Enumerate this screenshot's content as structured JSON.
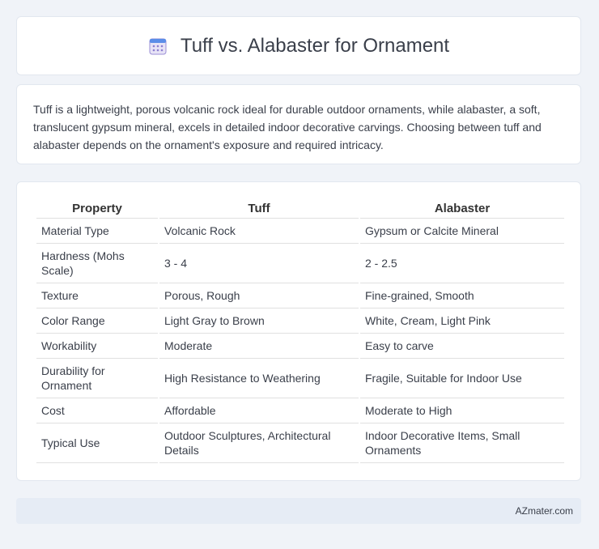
{
  "header": {
    "title": "Tuff vs. Alabaster for Ornament",
    "icon": "calendar-icon"
  },
  "intro": {
    "text": "Tuff is a lightweight, porous volcanic rock ideal for durable outdoor ornaments, while alabaster, a soft, translucent gypsum mineral, excels in detailed indoor decorative carvings. Choosing between tuff and alabaster depends on the ornament's exposure and required intricacy."
  },
  "table": {
    "headers": [
      "Property",
      "Tuff",
      "Alabaster"
    ],
    "rows": [
      [
        "Material Type",
        "Volcanic Rock",
        "Gypsum or Calcite Mineral"
      ],
      [
        "Hardness (Mohs Scale)",
        "3 - 4",
        "2 - 2.5"
      ],
      [
        "Texture",
        "Porous, Rough",
        "Fine-grained, Smooth"
      ],
      [
        "Color Range",
        "Light Gray to Brown",
        "White, Cream, Light Pink"
      ],
      [
        "Workability",
        "Moderate",
        "Easy to carve"
      ],
      [
        "Durability for Ornament",
        "High Resistance to Weathering",
        "Fragile, Suitable for Indoor Use"
      ],
      [
        "Cost",
        "Affordable",
        "Moderate to High"
      ],
      [
        "Typical Use",
        "Outdoor Sculptures, Architectural Details",
        "Indoor Decorative Items, Small Ornaments"
      ]
    ]
  },
  "footer": {
    "brand": "AZmater.com"
  }
}
